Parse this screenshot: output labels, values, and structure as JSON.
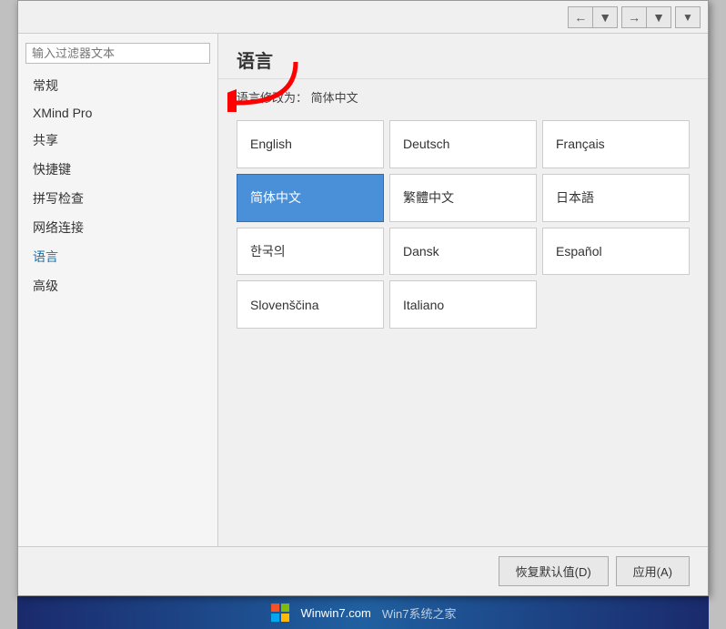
{
  "dialog": {
    "title": "语言",
    "subtitle_prefix": "语言修改为：",
    "subtitle_value": "简体中文"
  },
  "toolbar": {
    "back_label": "←",
    "forward_label": "→",
    "dropdown_label": "▼",
    "back2_label": "←",
    "dropdown2_label": "▼"
  },
  "sidebar": {
    "filter_placeholder": "输入过滤器文本",
    "items": [
      {
        "id": "general",
        "label": "常规"
      },
      {
        "id": "xmindpro",
        "label": "XMind Pro"
      },
      {
        "id": "share",
        "label": "共享"
      },
      {
        "id": "shortcuts",
        "label": "快捷键"
      },
      {
        "id": "spellcheck",
        "label": "拼写检查"
      },
      {
        "id": "network",
        "label": "网络连接"
      },
      {
        "id": "language",
        "label": "语言",
        "active": true
      },
      {
        "id": "advanced",
        "label": "高级"
      }
    ]
  },
  "languages": [
    {
      "id": "english",
      "label": "English",
      "selected": false
    },
    {
      "id": "deutsch",
      "label": "Deutsch",
      "selected": false
    },
    {
      "id": "francais",
      "label": "Français",
      "selected": false
    },
    {
      "id": "simp-chinese",
      "label": "简体中文",
      "selected": true
    },
    {
      "id": "trad-chinese",
      "label": "繁體中文",
      "selected": false
    },
    {
      "id": "japanese",
      "label": "日本語",
      "selected": false
    },
    {
      "id": "korean",
      "label": "한국의",
      "selected": false
    },
    {
      "id": "dansk",
      "label": "Dansk",
      "selected": false
    },
    {
      "id": "espanol",
      "label": "Español",
      "selected": false
    },
    {
      "id": "slovenscina",
      "label": "Slovenščina",
      "selected": false
    },
    {
      "id": "italiano",
      "label": "Italiano",
      "selected": false
    }
  ],
  "footer": {
    "restore_label": "恢复默认值(D)",
    "apply_label": "应用(A)"
  },
  "watermark": {
    "text": "Winwin7.com"
  }
}
